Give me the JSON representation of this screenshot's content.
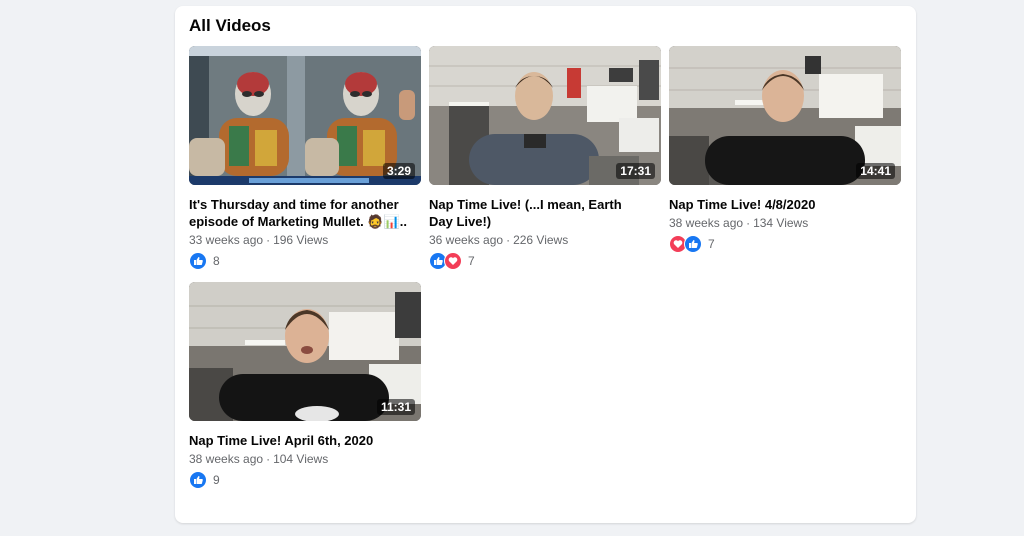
{
  "section": {
    "title": "All Videos"
  },
  "videos": [
    {
      "title_line1": "It's Thursday and time for another",
      "title_line2": "episode of Marketing Mullet. 🧔📊..",
      "age": "33 weeks ago",
      "views": "196 Views",
      "duration": "3:29",
      "reactions": [
        "like-icon"
      ],
      "reaction_count": "8"
    },
    {
      "title_line1": "Nap Time Live! (...I mean, Earth",
      "title_line2": "Day Live!)",
      "age": "36 weeks ago",
      "views": "226 Views",
      "duration": "17:31",
      "reactions": [
        "like-icon",
        "love-icon"
      ],
      "reaction_count": "7"
    },
    {
      "title_line1": "Nap Time Live! 4/8/2020",
      "title_line2": "",
      "age": "38 weeks ago",
      "views": "134 Views",
      "duration": "14:41",
      "reactions": [
        "love-icon",
        "like-icon"
      ],
      "reaction_count": "7"
    },
    {
      "title_line1": "Nap Time Live! April 6th, 2020",
      "title_line2": "",
      "age": "38 weeks ago",
      "views": "104 Views",
      "duration": "11:31",
      "reactions": [
        "like-icon"
      ],
      "reaction_count": "9"
    }
  ],
  "separator": "·",
  "colors": {
    "like": "#1877f2",
    "love": "#f33e58",
    "meta_text": "#65676b"
  }
}
